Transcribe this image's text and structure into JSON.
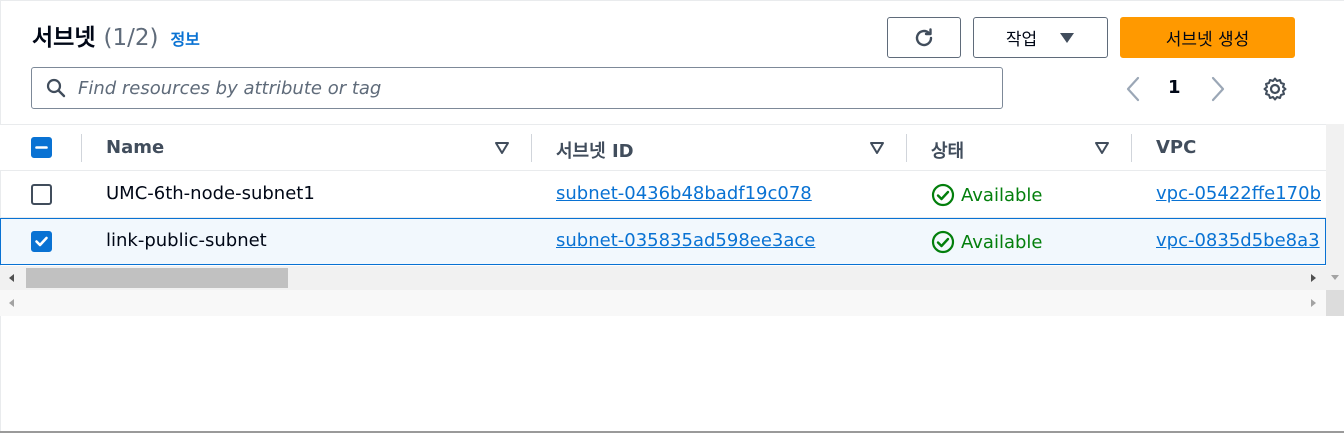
{
  "header": {
    "title": "서브넷",
    "count": "(1/2)",
    "info_label": "정보"
  },
  "toolbar": {
    "refresh_icon": "refresh-icon",
    "actions_label": "작업",
    "create_label": "서브넷 생성"
  },
  "search": {
    "placeholder": "Find resources by attribute or tag",
    "value": ""
  },
  "pagination": {
    "current_page": "1"
  },
  "table": {
    "columns": [
      {
        "label": "Name"
      },
      {
        "label": "서브넷 ID"
      },
      {
        "label": "상태"
      },
      {
        "label": "VPC"
      }
    ],
    "rows": [
      {
        "selected": false,
        "name": "UMC-6th-node-subnet1",
        "subnet_id": "subnet-0436b48badf19c078",
        "status": "Available",
        "vpc": "vpc-05422ffe170b"
      },
      {
        "selected": true,
        "name": "link-public-subnet",
        "subnet_id": "subnet-035835ad598ee3ace",
        "status": "Available",
        "vpc": "vpc-0835d5be8a3"
      }
    ]
  },
  "colors": {
    "accent": "#0972d3",
    "primary_button": "#ff9900",
    "status_success": "#037f0c"
  }
}
